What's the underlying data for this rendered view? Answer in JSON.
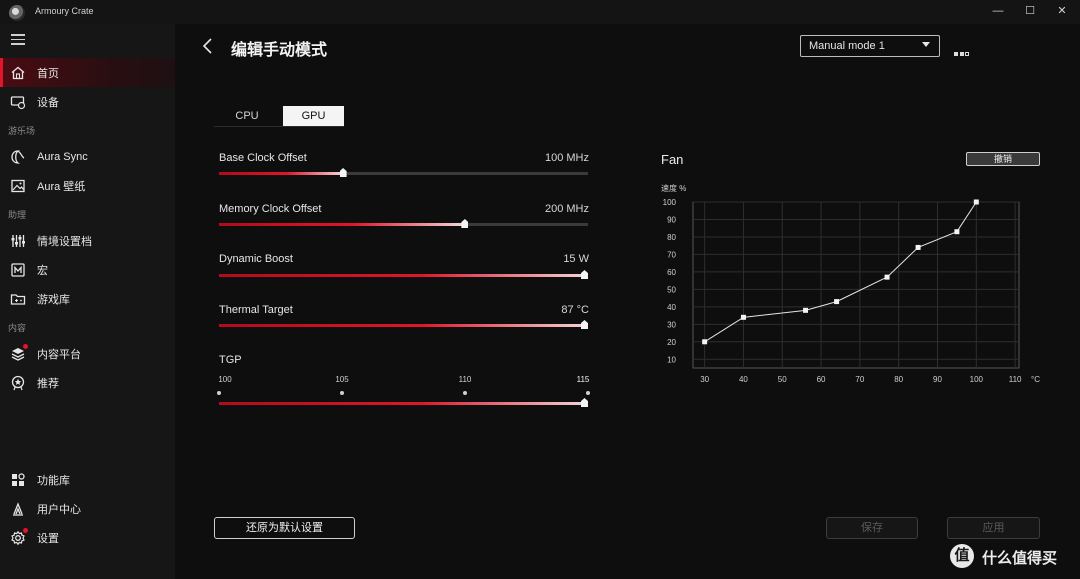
{
  "window": {
    "app_title": "Armoury Crate",
    "controls": [
      "—",
      "☐",
      "✕"
    ]
  },
  "sidebar": {
    "items": [
      {
        "label": "首页",
        "icon": "home-icon",
        "active": true
      },
      {
        "label": "设备",
        "icon": "device-icon"
      },
      {
        "section": "游乐场"
      },
      {
        "label": "Aura Sync",
        "icon": "aura-sync-icon"
      },
      {
        "label": "Aura 壁纸",
        "icon": "wallpaper-icon"
      },
      {
        "section": "助理"
      },
      {
        "label": "情境设置档",
        "icon": "scenario-profile-icon"
      },
      {
        "label": "宏",
        "icon": "macro-icon"
      },
      {
        "label": "游戏库",
        "icon": "game-library-icon"
      },
      {
        "section": "内容"
      },
      {
        "label": "内容平台",
        "icon": "content-platform-icon",
        "badge": true
      },
      {
        "label": "推荐",
        "icon": "recommend-icon"
      },
      {
        "label": "功能库",
        "icon": "feature-library-icon"
      },
      {
        "label": "用户中心",
        "icon": "user-center-icon"
      },
      {
        "label": "设置",
        "icon": "settings-icon",
        "badge": true
      }
    ],
    "labels": {
      "home": "首页",
      "device": "设备",
      "section_playground": "游乐场",
      "aura_sync": "Aura Sync",
      "aura_wallpaper": "Aura 壁纸",
      "section_assistant": "助理",
      "scenario": "情境设置档",
      "macro": "宏",
      "game_library": "游戏库",
      "section_content": "内容",
      "content_platform": "内容平台",
      "recommend": "推荐",
      "feature_library": "功能库",
      "user_center": "用户中心",
      "settings": "设置"
    }
  },
  "header": {
    "title": "编辑手动模式",
    "mode_select": "Manual mode 1"
  },
  "tabs": {
    "cpu": "CPU",
    "gpu": "GPU",
    "selected": "GPU"
  },
  "sliders": {
    "base_clock": {
      "label": "Base Clock Offset",
      "value": "100 MHz",
      "fraction": 0.335
    },
    "memory_clock": {
      "label": "Memory Clock Offset",
      "value": "200 MHz",
      "fraction": 0.665
    },
    "dynamic_boost": {
      "label": "Dynamic Boost",
      "value": "15 W",
      "fraction": 1.0
    },
    "thermal_target": {
      "label": "Thermal Target",
      "value": "87 °C",
      "fraction": 1.0
    },
    "tgp": {
      "label": "TGP",
      "ticks": [
        "100",
        "105",
        "110",
        "115"
      ],
      "selected": "115",
      "fraction": 1.0
    }
  },
  "fan": {
    "title": "Fan",
    "undo_label": "撤销",
    "y_axis_label": "速度 %",
    "x_unit": "°C"
  },
  "chart_data": {
    "type": "line",
    "title": "Fan",
    "ylabel": "速度 %",
    "xlabel": "°C",
    "x_ticks": [
      30,
      40,
      50,
      60,
      70,
      80,
      90,
      100,
      110
    ],
    "y_ticks": [
      10,
      20,
      30,
      40,
      50,
      60,
      70,
      80,
      90,
      100
    ],
    "xlim": [
      27,
      111
    ],
    "ylim": [
      5,
      100
    ],
    "grid": true,
    "series": [
      {
        "x": [
          30,
          40,
          56,
          64,
          77,
          85,
          95,
          100
        ],
        "y": [
          20,
          34,
          38,
          43,
          57,
          74,
          83,
          100
        ]
      }
    ]
  },
  "footer": {
    "reset_label": "还原为默认设置",
    "save_label": "保存",
    "apply_label": "应用"
  },
  "watermark": {
    "badge": "值",
    "text": "什么值得买"
  },
  "colors": {
    "accent": "#e0162b",
    "background": "#0e0e0e",
    "sidebar": "#161616"
  }
}
